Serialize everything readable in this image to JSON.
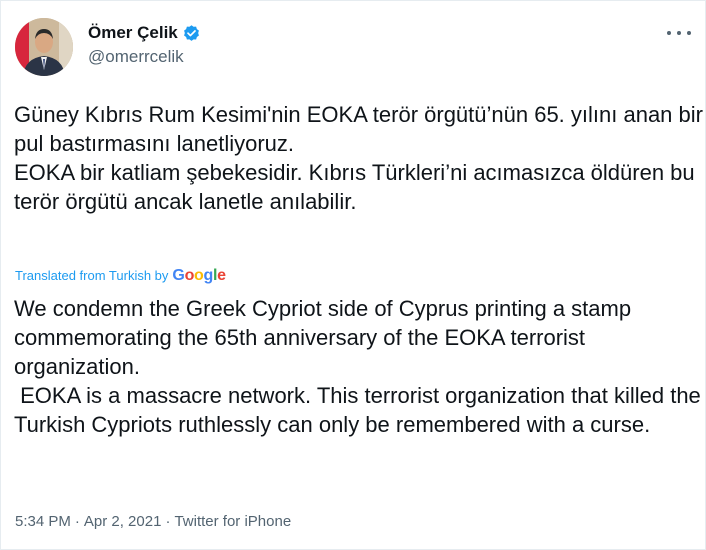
{
  "author": {
    "display_name": "Ömer Çelik",
    "handle": "@omerrcelik",
    "verified": true
  },
  "tweet": {
    "text": "Güney Kıbrıs Rum Kesimi'nin EOKA terör örgütü’nün 65. yılını anan bir pul bastırmasını lanetliyoruz.\nEOKA bir katliam şebekesidir. Kıbrıs Türkleri’ni acımasızca öldüren bu terör örgütü ancak lanetle anılabilir.",
    "translated_label": "Translated from Turkish by",
    "translation_provider": "Google",
    "translation": "We condemn the Greek Cypriot side of Cyprus printing a stamp commemorating the 65th anniversary of the EOKA terrorist organization.\n EOKA is a massacre network. This terrorist organization that killed the Turkish Cypriots ruthlessly can only be remembered with a curse."
  },
  "meta": {
    "time": "5:34 PM",
    "separator": "·",
    "date": "Apr 2, 2021",
    "source": "Twitter for iPhone"
  },
  "icons": {
    "verified": "verified-badge-icon",
    "more": "more-options-icon"
  },
  "colors": {
    "accent": "#1d9bf0",
    "text": "#0f1419",
    "secondary": "#536471"
  }
}
